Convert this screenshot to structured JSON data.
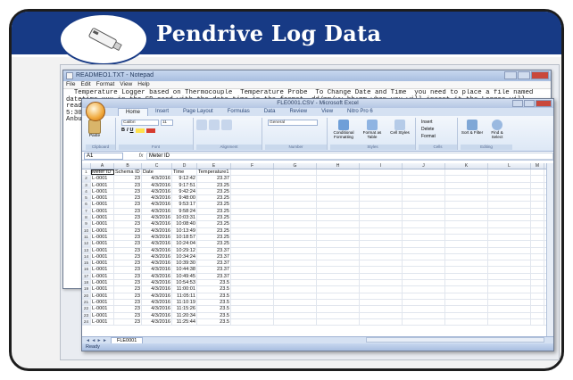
{
  "header": {
    "title": "Pendrive Log Data",
    "logo_icon": "usb-pendrive-icon"
  },
  "notepad": {
    "title": "READMEO1.TXT - Notepad",
    "menu": [
      "File",
      "Edit",
      "Format",
      "View",
      "Help"
    ],
    "text": "  Temperature Logger based on Thermocouple  Temperature Probe  To Change Date and Time  you need to place a file named datetime.xxx in the SD card with the date time in the format  dd/mm/yy hh:mm when you will insert it the Logger will read this file and set its date-time ,for example, if today is 27th Nov 2016 and your are planning to insert it at 5:30PM the file named datetime.xxx should contain 27/11/2016 17:30 This Product is Designed and Developed in India by Anbuli technologies For feedback and support, please email to info@anbulli.com"
  },
  "excel": {
    "title": "FLE0001.CSV - Microsoft Excel",
    "tabs": [
      "Home",
      "Insert",
      "Page Layout",
      "Formulas",
      "Data",
      "Review",
      "View",
      "Nitro Pro 6"
    ],
    "ribbon": {
      "paste_label": "Paste",
      "font_name": "Calibri",
      "font_size": "11",
      "number_format": "General",
      "conditional_label": "Conditional Formatting",
      "format_table_label": "Format as Table",
      "cell_styles_label": "Cell Styles",
      "insert_label": "Insert",
      "delete_label": "Delete",
      "format_label": "Format",
      "sort_label": "Sort & Filter",
      "find_label": "Find & Select",
      "groups": [
        "Clipboard",
        "Font",
        "Alignment",
        "Number",
        "Styles",
        "Cells",
        "Editing"
      ]
    },
    "name_box": "A1",
    "formula_value": "Meter ID",
    "columns": [
      "A",
      "B",
      "C",
      "D",
      "E",
      "F",
      "G",
      "H",
      "I",
      "J",
      "K",
      "L",
      "M"
    ],
    "headers": [
      "Meter ID",
      "Schema ID",
      "Date",
      "Time",
      "Temperature1"
    ],
    "rows": [
      [
        "L-0001",
        "23",
        "4/3/2016",
        "9:12:42",
        "23.37"
      ],
      [
        "L-0001",
        "23",
        "4/3/2016",
        "9:17:51",
        "23.25"
      ],
      [
        "L-0001",
        "23",
        "4/3/2016",
        "9:42:24",
        "23.25"
      ],
      [
        "L-0001",
        "23",
        "4/3/2016",
        "9:48:00",
        "23.25"
      ],
      [
        "L-0001",
        "23",
        "4/3/2016",
        "9:53:17",
        "23.25"
      ],
      [
        "L-0001",
        "23",
        "4/3/2016",
        "9:58:24",
        "23.25"
      ],
      [
        "L-0001",
        "23",
        "4/3/2016",
        "10:03:31",
        "23.25"
      ],
      [
        "L-0001",
        "23",
        "4/3/2016",
        "10:08:40",
        "23.25"
      ],
      [
        "L-0001",
        "23",
        "4/3/2016",
        "10:13:49",
        "23.25"
      ],
      [
        "L-0001",
        "23",
        "4/3/2016",
        "10:18:57",
        "23.25"
      ],
      [
        "L-0001",
        "23",
        "4/3/2016",
        "10:24:04",
        "23.25"
      ],
      [
        "L-0001",
        "23",
        "4/3/2016",
        "10:29:12",
        "23.37"
      ],
      [
        "L-0001",
        "23",
        "4/3/2016",
        "10:34:24",
        "23.37"
      ],
      [
        "L-0001",
        "23",
        "4/3/2016",
        "10:39:30",
        "23.37"
      ],
      [
        "L-0001",
        "23",
        "4/3/2016",
        "10:44:38",
        "23.37"
      ],
      [
        "L-0001",
        "23",
        "4/3/2016",
        "10:49:45",
        "23.37"
      ],
      [
        "L-0001",
        "23",
        "4/3/2016",
        "10:54:53",
        "23.5"
      ],
      [
        "L-0001",
        "23",
        "4/3/2016",
        "11:00:01",
        "23.5"
      ],
      [
        "L-0001",
        "23",
        "4/3/2016",
        "11:05:11",
        "23.5"
      ],
      [
        "L-0001",
        "23",
        "4/3/2016",
        "11:10:19",
        "23.5"
      ],
      [
        "L-0001",
        "23",
        "4/3/2016",
        "11:15:26",
        "23.5"
      ],
      [
        "L-0001",
        "23",
        "4/3/2016",
        "11:20:34",
        "23.5"
      ],
      [
        "L-0001",
        "23",
        "4/3/2016",
        "11:25:44",
        "23.5"
      ]
    ],
    "sheet_tab": "FLE0001",
    "status": "Ready"
  }
}
